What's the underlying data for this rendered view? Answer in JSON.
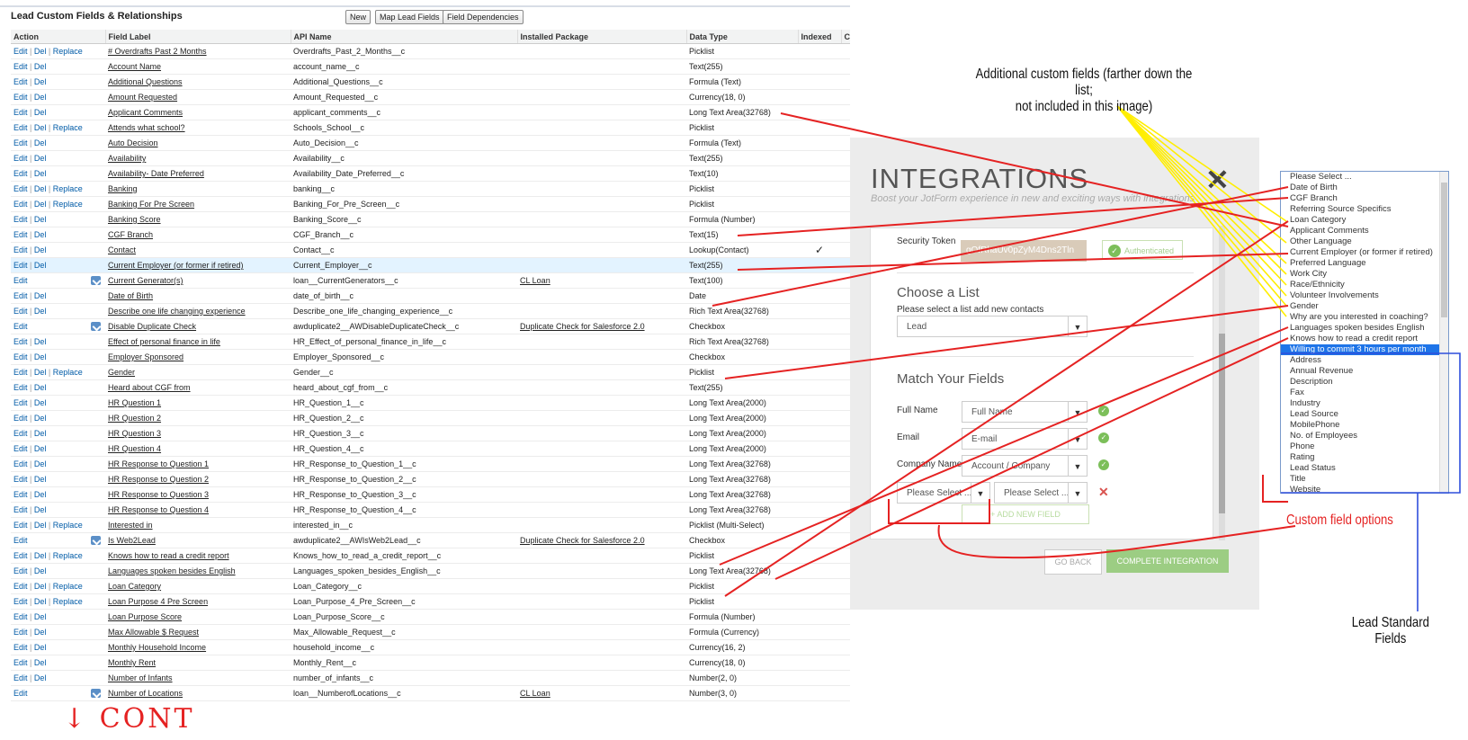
{
  "salesforce": {
    "title": "Lead Custom Fields & Relationships",
    "buttons": [
      "New",
      "Map Lead Fields",
      "Field Dependencies"
    ],
    "columns": [
      "Action",
      "Field Label",
      "API Name",
      "Installed Package",
      "Data Type",
      "Indexed",
      "C"
    ],
    "rows": [
      {
        "actions": [
          "Edit",
          "Del",
          "Replace"
        ],
        "label": "# Overdrafts Past 2 Months",
        "api": "Overdrafts_Past_2_Months__c",
        "pkg": "",
        "type": "Picklist",
        "indexed": "",
        "icon": false
      },
      {
        "actions": [
          "Edit",
          "Del"
        ],
        "label": "Account Name",
        "api": "account_name__c",
        "pkg": "",
        "type": "Text(255)",
        "indexed": "",
        "icon": false
      },
      {
        "actions": [
          "Edit",
          "Del"
        ],
        "label": "Additional Questions",
        "api": "Additional_Questions__c",
        "pkg": "",
        "type": "Formula (Text)",
        "indexed": "",
        "icon": false
      },
      {
        "actions": [
          "Edit",
          "Del"
        ],
        "label": "Amount Requested",
        "api": "Amount_Requested__c",
        "pkg": "",
        "type": "Currency(18, 0)",
        "indexed": "",
        "icon": false
      },
      {
        "actions": [
          "Edit",
          "Del"
        ],
        "label": "Applicant Comments",
        "api": "applicant_comments__c",
        "pkg": "",
        "type": "Long Text Area(32768)",
        "indexed": "",
        "icon": false
      },
      {
        "actions": [
          "Edit",
          "Del",
          "Replace"
        ],
        "label": "Attends what school?",
        "api": "Schools_School__c",
        "pkg": "",
        "type": "Picklist",
        "indexed": "",
        "icon": false
      },
      {
        "actions": [
          "Edit",
          "Del"
        ],
        "label": "Auto Decision",
        "api": "Auto_Decision__c",
        "pkg": "",
        "type": "Formula (Text)",
        "indexed": "",
        "icon": false
      },
      {
        "actions": [
          "Edit",
          "Del"
        ],
        "label": "Availability",
        "api": "Availability__c",
        "pkg": "",
        "type": "Text(255)",
        "indexed": "",
        "icon": false
      },
      {
        "actions": [
          "Edit",
          "Del"
        ],
        "label": "Availability- Date Preferred",
        "api": "Availability_Date_Preferred__c",
        "pkg": "",
        "type": "Text(10)",
        "indexed": "",
        "icon": false
      },
      {
        "actions": [
          "Edit",
          "Del",
          "Replace"
        ],
        "label": "Banking",
        "api": "banking__c",
        "pkg": "",
        "type": "Picklist",
        "indexed": "",
        "icon": false
      },
      {
        "actions": [
          "Edit",
          "Del",
          "Replace"
        ],
        "label": "Banking For Pre Screen",
        "api": "Banking_For_Pre_Screen__c",
        "pkg": "",
        "type": "Picklist",
        "indexed": "",
        "icon": false
      },
      {
        "actions": [
          "Edit",
          "Del"
        ],
        "label": "Banking Score",
        "api": "Banking_Score__c",
        "pkg": "",
        "type": "Formula (Number)",
        "indexed": "",
        "icon": false
      },
      {
        "actions": [
          "Edit",
          "Del"
        ],
        "label": "CGF Branch",
        "api": "CGF_Branch__c",
        "pkg": "",
        "type": "Text(15)",
        "indexed": "",
        "icon": false
      },
      {
        "actions": [
          "Edit",
          "Del"
        ],
        "label": "Contact",
        "api": "Contact__c",
        "pkg": "",
        "type": "Lookup(Contact)",
        "indexed": "✓",
        "icon": false
      },
      {
        "actions": [
          "Edit",
          "Del"
        ],
        "label": "Current Employer (or former if retired)",
        "api": "Current_Employer__c",
        "pkg": "",
        "type": "Text(255)",
        "indexed": "",
        "icon": false,
        "hl": true
      },
      {
        "actions": [
          "Edit"
        ],
        "label": "Current Generator(s)",
        "api": "loan__CurrentGenerators__c",
        "pkg": "CL Loan",
        "type": "Text(100)",
        "indexed": "",
        "icon": true
      },
      {
        "actions": [
          "Edit",
          "Del"
        ],
        "label": "Date of Birth",
        "api": "date_of_birth__c",
        "pkg": "",
        "type": "Date",
        "indexed": "",
        "icon": false
      },
      {
        "actions": [
          "Edit",
          "Del"
        ],
        "label": "Describe one life changing experience",
        "api": "Describe_one_life_changing_experience__c",
        "pkg": "",
        "type": "Rich Text Area(32768)",
        "indexed": "",
        "icon": false
      },
      {
        "actions": [
          "Edit"
        ],
        "label": "Disable Duplicate Check",
        "api": "awduplicate2__AWDisableDuplicateCheck__c",
        "pkg": "Duplicate Check for Salesforce 2.0",
        "type": "Checkbox",
        "indexed": "",
        "icon": true
      },
      {
        "actions": [
          "Edit",
          "Del"
        ],
        "label": "Effect of personal finance in life",
        "api": "HR_Effect_of_personal_finance_in_life__c",
        "pkg": "",
        "type": "Rich Text Area(32768)",
        "indexed": "",
        "icon": false
      },
      {
        "actions": [
          "Edit",
          "Del"
        ],
        "label": "Employer Sponsored",
        "api": "Employer_Sponsored__c",
        "pkg": "",
        "type": "Checkbox",
        "indexed": "",
        "icon": false
      },
      {
        "actions": [
          "Edit",
          "Del",
          "Replace"
        ],
        "label": "Gender",
        "api": "Gender__c",
        "pkg": "",
        "type": "Picklist",
        "indexed": "",
        "icon": false
      },
      {
        "actions": [
          "Edit",
          "Del"
        ],
        "label": "Heard about CGF from",
        "api": "heard_about_cgf_from__c",
        "pkg": "",
        "type": "Text(255)",
        "indexed": "",
        "icon": false
      },
      {
        "actions": [
          "Edit",
          "Del"
        ],
        "label": "HR Question 1",
        "api": "HR_Question_1__c",
        "pkg": "",
        "type": "Long Text Area(2000)",
        "indexed": "",
        "icon": false
      },
      {
        "actions": [
          "Edit",
          "Del"
        ],
        "label": "HR Question 2",
        "api": "HR_Question_2__c",
        "pkg": "",
        "type": "Long Text Area(2000)",
        "indexed": "",
        "icon": false
      },
      {
        "actions": [
          "Edit",
          "Del"
        ],
        "label": "HR Question 3",
        "api": "HR_Question_3__c",
        "pkg": "",
        "type": "Long Text Area(2000)",
        "indexed": "",
        "icon": false
      },
      {
        "actions": [
          "Edit",
          "Del"
        ],
        "label": "HR Question 4",
        "api": "HR_Question_4__c",
        "pkg": "",
        "type": "Long Text Area(2000)",
        "indexed": "",
        "icon": false
      },
      {
        "actions": [
          "Edit",
          "Del"
        ],
        "label": "HR Response to Question 1",
        "api": "HR_Response_to_Question_1__c",
        "pkg": "",
        "type": "Long Text Area(32768)",
        "indexed": "",
        "icon": false
      },
      {
        "actions": [
          "Edit",
          "Del"
        ],
        "label": "HR Response to Question 2",
        "api": "HR_Response_to_Question_2__c",
        "pkg": "",
        "type": "Long Text Area(32768)",
        "indexed": "",
        "icon": false
      },
      {
        "actions": [
          "Edit",
          "Del"
        ],
        "label": "HR Response to Question 3",
        "api": "HR_Response_to_Question_3__c",
        "pkg": "",
        "type": "Long Text Area(32768)",
        "indexed": "",
        "icon": false
      },
      {
        "actions": [
          "Edit",
          "Del"
        ],
        "label": "HR Response to Question 4",
        "api": "HR_Response_to_Question_4__c",
        "pkg": "",
        "type": "Long Text Area(32768)",
        "indexed": "",
        "icon": false
      },
      {
        "actions": [
          "Edit",
          "Del",
          "Replace"
        ],
        "label": "Interested in",
        "api": "interested_in__c",
        "pkg": "",
        "type": "Picklist (Multi-Select)",
        "indexed": "",
        "icon": false
      },
      {
        "actions": [
          "Edit"
        ],
        "label": "Is Web2Lead",
        "api": "awduplicate2__AWIsWeb2Lead__c",
        "pkg": "Duplicate Check for Salesforce 2.0",
        "type": "Checkbox",
        "indexed": "",
        "icon": true
      },
      {
        "actions": [
          "Edit",
          "Del",
          "Replace"
        ],
        "label": "Knows how to read a credit report",
        "api": "Knows_how_to_read_a_credit_report__c",
        "pkg": "",
        "type": "Picklist",
        "indexed": "",
        "icon": false
      },
      {
        "actions": [
          "Edit",
          "Del"
        ],
        "label": "Languages spoken besides English",
        "api": "Languages_spoken_besides_English__c",
        "pkg": "",
        "type": "Long Text Area(32768)",
        "indexed": "",
        "icon": false
      },
      {
        "actions": [
          "Edit",
          "Del",
          "Replace"
        ],
        "label": "Loan Category",
        "api": "Loan_Category__c",
        "pkg": "",
        "type": "Picklist",
        "indexed": "",
        "icon": false
      },
      {
        "actions": [
          "Edit",
          "Del",
          "Replace"
        ],
        "label": "Loan Purpose 4 Pre Screen",
        "api": "Loan_Purpose_4_Pre_Screen__c",
        "pkg": "",
        "type": "Picklist",
        "indexed": "",
        "icon": false
      },
      {
        "actions": [
          "Edit",
          "Del"
        ],
        "label": "Loan Purpose Score",
        "api": "Loan_Purpose_Score__c",
        "pkg": "",
        "type": "Formula (Number)",
        "indexed": "",
        "icon": false
      },
      {
        "actions": [
          "Edit",
          "Del"
        ],
        "label": "Max Allowable $ Request",
        "api": "Max_Allowable_Request__c",
        "pkg": "",
        "type": "Formula (Currency)",
        "indexed": "",
        "icon": false
      },
      {
        "actions": [
          "Edit",
          "Del"
        ],
        "label": "Monthly Household Income",
        "api": "household_income__c",
        "pkg": "",
        "type": "Currency(16, 2)",
        "indexed": "",
        "icon": false
      },
      {
        "actions": [
          "Edit",
          "Del"
        ],
        "label": "Monthly Rent",
        "api": "Monthly_Rent__c",
        "pkg": "",
        "type": "Currency(18, 0)",
        "indexed": "",
        "icon": false
      },
      {
        "actions": [
          "Edit",
          "Del"
        ],
        "label": "Number of Infants",
        "api": "number_of_infants__c",
        "pkg": "",
        "type": "Number(2, 0)",
        "indexed": "",
        "icon": false
      },
      {
        "actions": [
          "Edit"
        ],
        "label": "Number of Locations",
        "api": "loan__NumberofLocations__c",
        "pkg": "CL Loan",
        "type": "Number(3, 0)",
        "indexed": "",
        "icon": true
      }
    ]
  },
  "integrations": {
    "title": "INTEGRATIONS",
    "subtitle": "Boost your JotForm experience in new and exciting ways with integrations",
    "close": "✕",
    "security_token_label": "Security Token",
    "security_token_value": "gOfRhaUv0pZyM4Dns2Tln",
    "authenticated": "Authenticated",
    "choose_list_heading": "Choose a List",
    "choose_list_help": "Please select a list add new contacts",
    "list_value": "Lead",
    "match_heading": "Match Your Fields",
    "fields": [
      {
        "label": "Full Name",
        "value": "Full Name"
      },
      {
        "label": "Email",
        "value": "E-mail"
      },
      {
        "label": "Company Name",
        "value": "Account / Company"
      }
    ],
    "please_select_left": "Please Select ...",
    "please_select_right": "Please Select ...",
    "add_new_field": "+ ADD NEW FIELD",
    "go_back": "GO BACK",
    "complete": "COMPLETE INTEGRATION"
  },
  "dropdown": {
    "options": [
      "Please Select ...",
      "Date of Birth",
      "CGF Branch",
      "Referring Source Specifics",
      "Loan Category",
      "Applicant Comments",
      "Other Language",
      "Current Employer (or former if retired)",
      "Preferred Language",
      "Work City",
      "Race/Ethnicity",
      "Volunteer Involvements",
      "Gender",
      "Why are you interested in coaching?",
      "Languages spoken besides English",
      "Knows how to read a credit report",
      "Willing to commit 3 hours per month",
      "Address",
      "Annual Revenue",
      "Description",
      "Fax",
      "Industry",
      "Lead Source",
      "MobilePhone",
      "No. of Employees",
      "Phone",
      "Rating",
      "Lead Status",
      "Title",
      "Website"
    ],
    "selected_index": 16
  },
  "annotations": {
    "additional_line1": "Additional custom fields (farther down the list;",
    "additional_line2": "not included in this image)",
    "custom_options": "Custom field options",
    "standard_fields": "Lead Standard Fields",
    "cont": "↓ CONT"
  },
  "colors": {
    "annot_red": "#e52222",
    "annot_yellow": "#ffee00",
    "annot_blue": "#2f4fdc",
    "link_blue": "#015ba7",
    "highlight": "#e3f3ff"
  }
}
